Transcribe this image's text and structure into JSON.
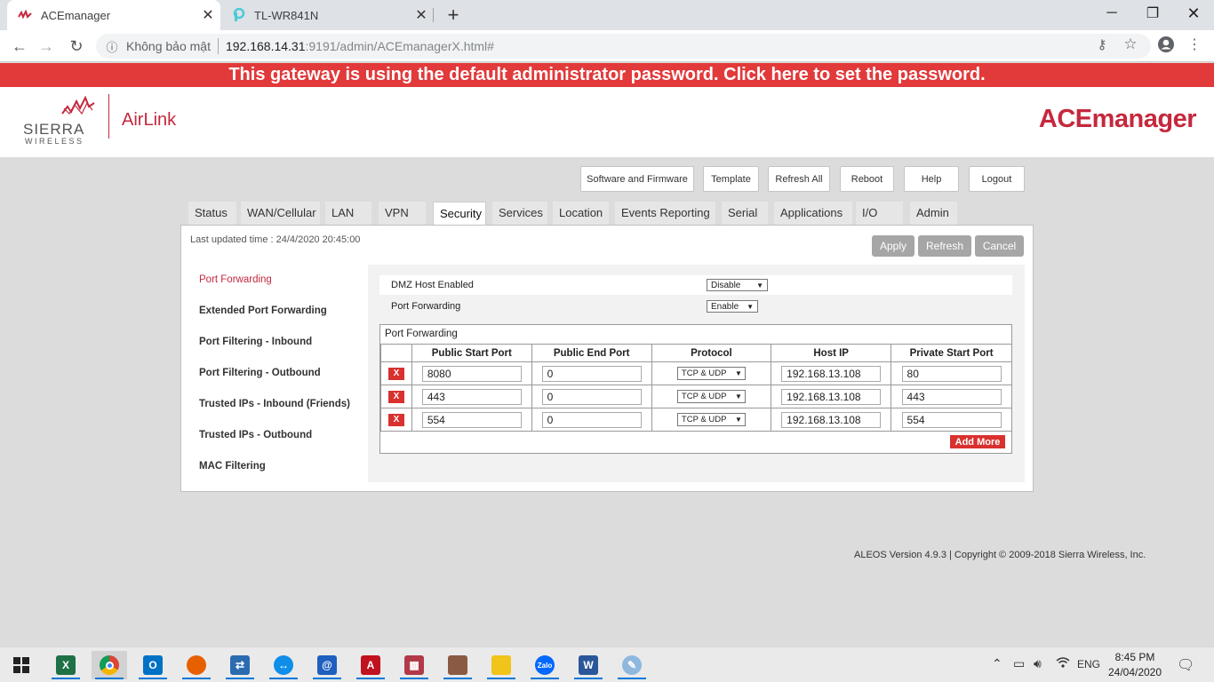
{
  "browser": {
    "tabs": [
      {
        "title": "ACEmanager",
        "active": true
      },
      {
        "title": "TL-WR841N",
        "active": false
      }
    ],
    "security_label": "Không bảo mật",
    "url_host": "192.168.14.31",
    "url_path": ":9191/admin/ACEmanagerX.html#"
  },
  "banner": "This gateway is using the default administrator password. Click here to set the password.",
  "header": {
    "logo_sierra": "SIERRA",
    "logo_wireless": "WIRELESS",
    "logo_airlink": "AirLink",
    "brand": "ACEmanager"
  },
  "toolbar": [
    "Software and Firmware",
    "Template",
    "Refresh All",
    "Reboot",
    "Help",
    "Logout"
  ],
  "main_tabs": [
    "Status",
    "WAN/Cellular",
    "LAN",
    "VPN",
    "Security",
    "Services",
    "Location",
    "Events Reporting",
    "Serial",
    "Applications",
    "I/O",
    "Admin"
  ],
  "active_tab": "Security",
  "panel": {
    "last_updated": "Last updated time : 24/4/2020 20:45:00",
    "actions": [
      "Apply",
      "Refresh",
      "Cancel"
    ]
  },
  "sidebar": [
    "Port Forwarding",
    "Extended Port Forwarding",
    "Port Filtering - Inbound",
    "Port Filtering - Outbound",
    "Trusted IPs - Inbound (Friends)",
    "Trusted IPs - Outbound",
    "MAC Filtering"
  ],
  "settings": {
    "dmz_label": "DMZ Host Enabled",
    "dmz_value": "Disable",
    "pf_label": "Port Forwarding",
    "pf_value": "Enable"
  },
  "port_forwarding": {
    "title": "Port Forwarding",
    "delete_label": "X",
    "add_more": "Add More",
    "columns": [
      "Public Start Port",
      "Public End Port",
      "Protocol",
      "Host IP",
      "Private Start Port"
    ],
    "rows": [
      {
        "public_start": "8080",
        "public_end": "0",
        "protocol": "TCP & UDP",
        "host_ip": "192.168.13.108",
        "private_start": "80"
      },
      {
        "public_start": "443",
        "public_end": "0",
        "protocol": "TCP & UDP",
        "host_ip": "192.168.13.108",
        "private_start": "443"
      },
      {
        "public_start": "554",
        "public_end": "0",
        "protocol": "TCP & UDP",
        "host_ip": "192.168.13.108",
        "private_start": "554"
      }
    ]
  },
  "footer": "ALEOS Version 4.9.3 | Copyright © 2009-2018 Sierra Wireless, Inc.",
  "taskbar": {
    "apps": [
      "excel-icon",
      "chrome-icon",
      "outlook-icon",
      "firefox-icon",
      "remote-desktop-icon",
      "teamviewer-icon",
      "app-icon",
      "autocad-icon",
      "photo-app-icon",
      "game-icon",
      "file-explorer-icon",
      "zalo-icon",
      "word-icon",
      "paint-icon"
    ],
    "zalo_label": "Zalo",
    "language": "ENG",
    "time": "8:45 PM",
    "date": "24/04/2020"
  },
  "colors": {
    "brand_red": "#c5283d",
    "banner_red": "#e2393a",
    "delete_red": "#d9312e",
    "button_grey": "#a6a6a6"
  }
}
